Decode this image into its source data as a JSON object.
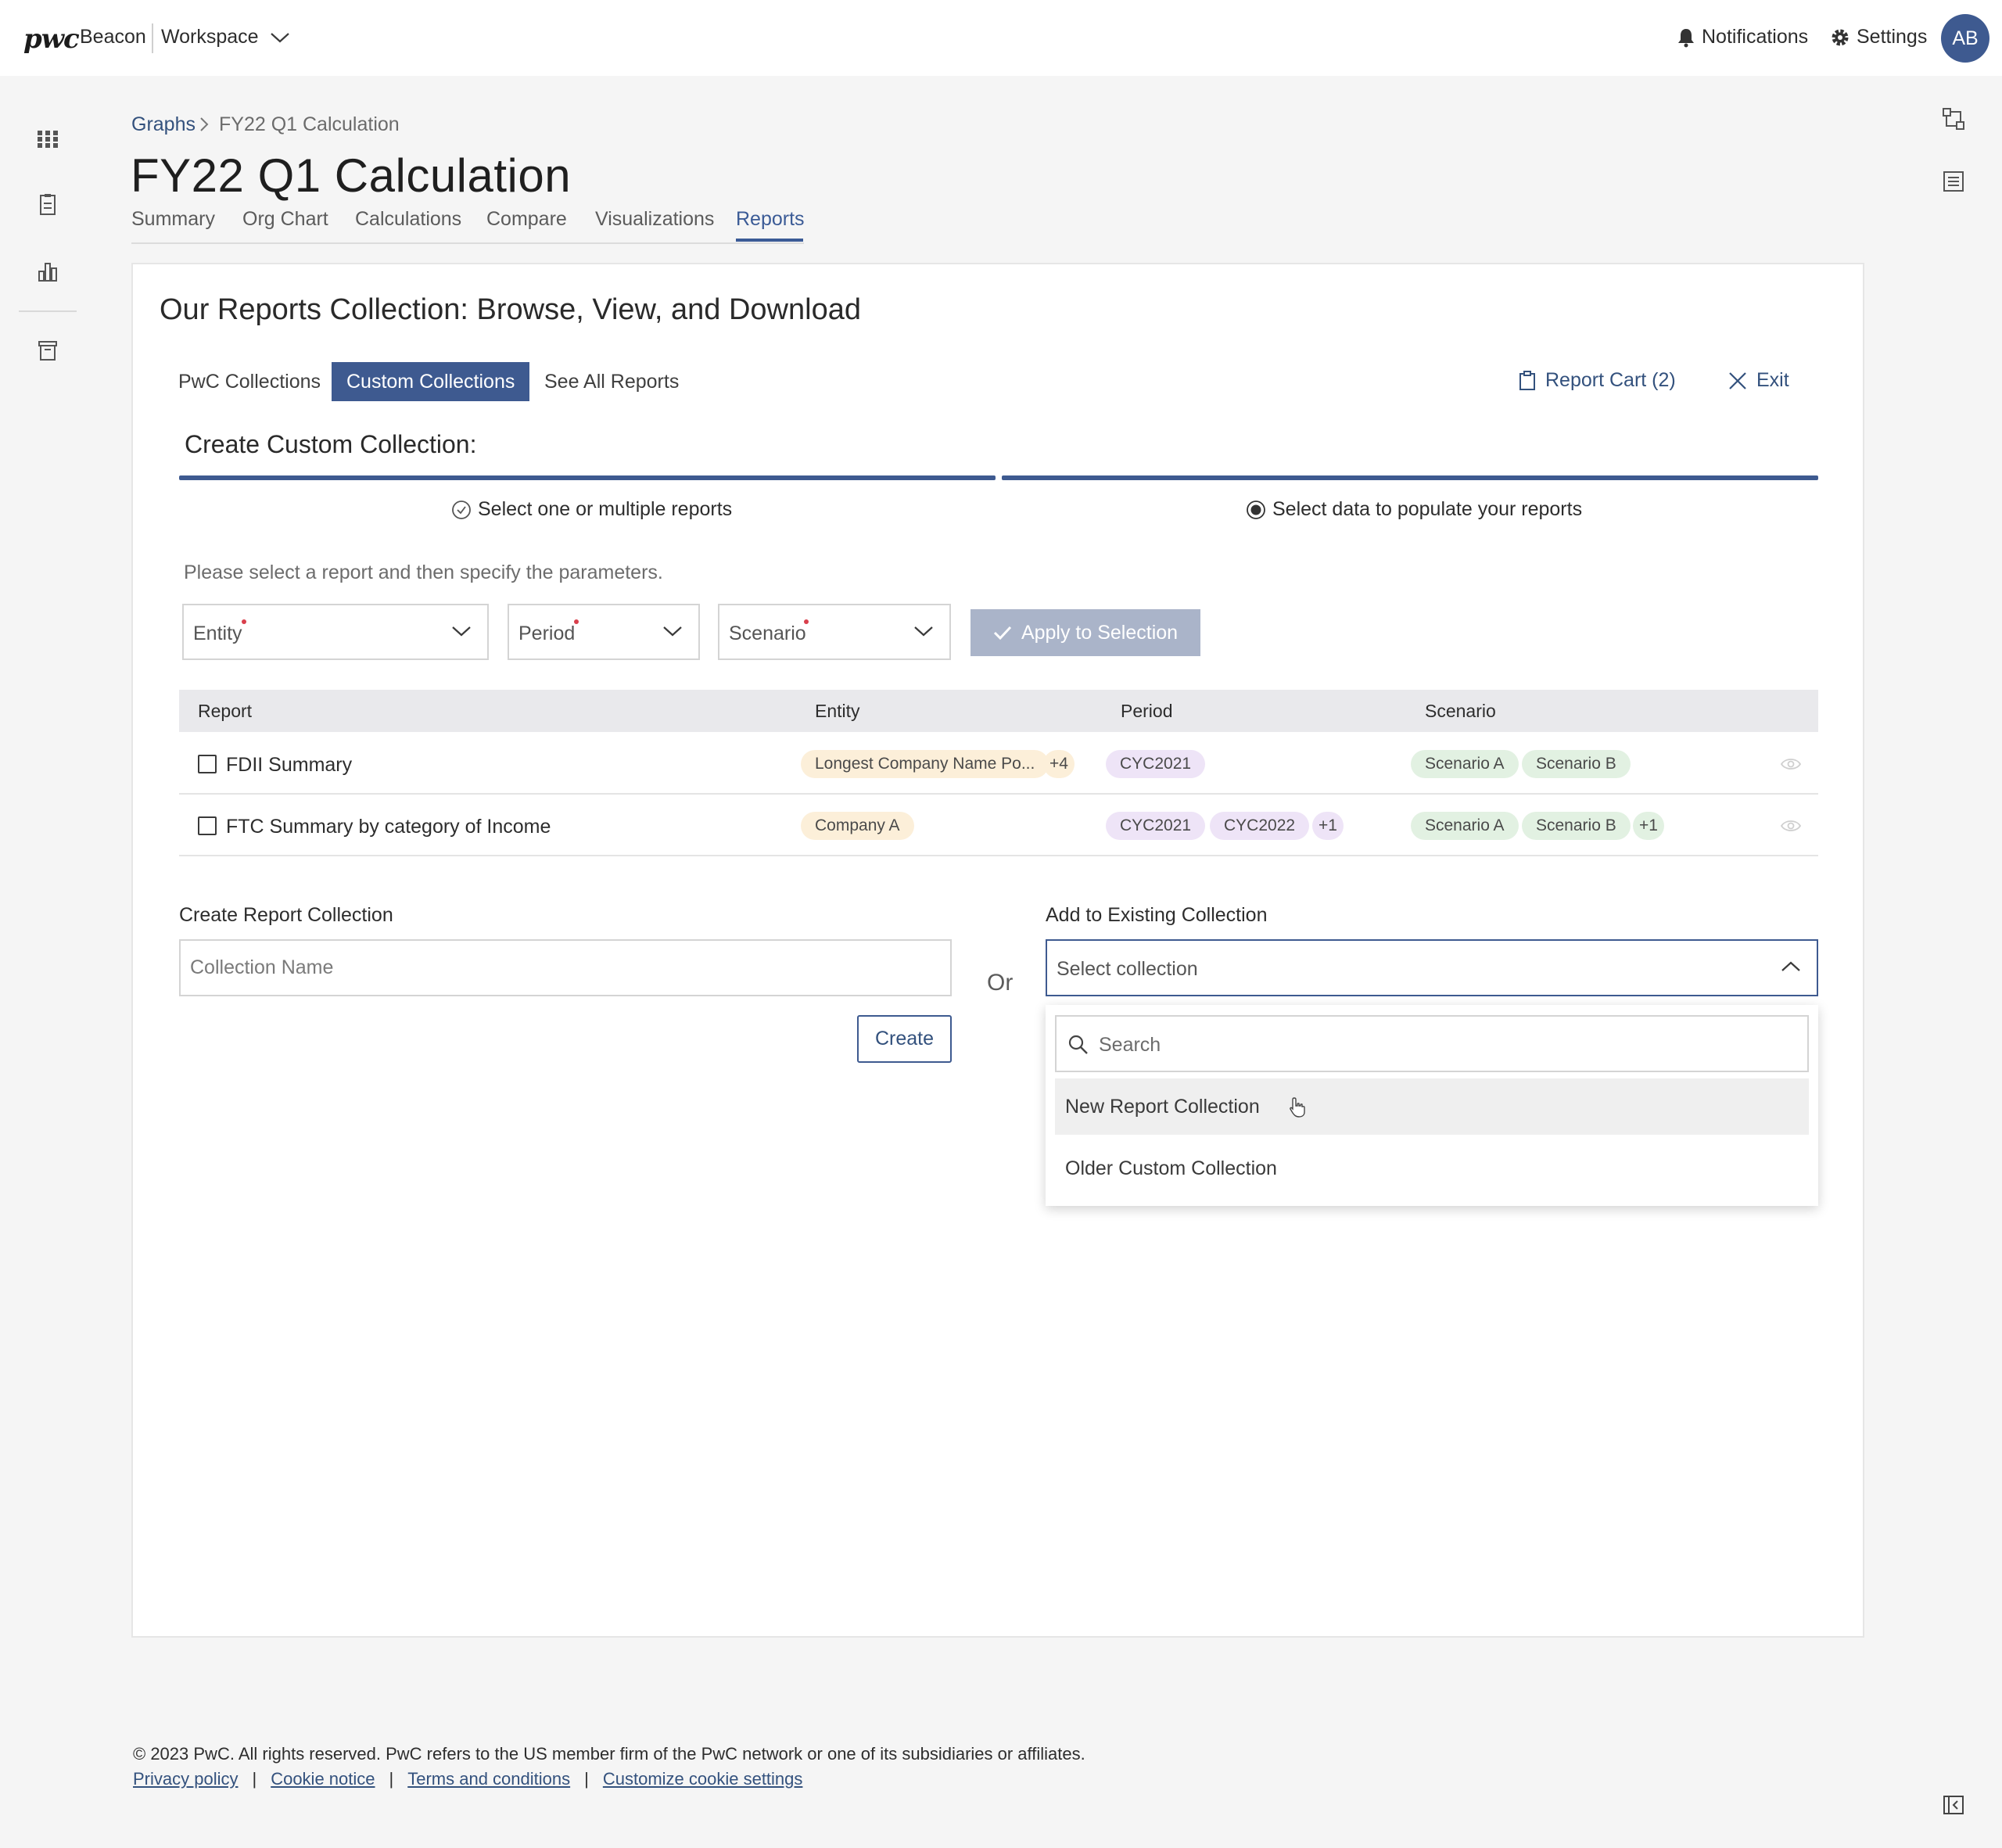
{
  "header": {
    "logo": "pwc",
    "product": "Beacon",
    "workspace": "Workspace",
    "notifications": "Notifications",
    "settings": "Settings",
    "avatar_initials": "AB"
  },
  "left_rail": {
    "icons": [
      "grid-icon",
      "document-icon",
      "chart-icon",
      "archive-icon"
    ]
  },
  "right_rail": {
    "icons": [
      "diagram-icon",
      "list-icon",
      "collapse-panel-icon"
    ]
  },
  "breadcrumb": {
    "parent": "Graphs",
    "current": "FY22 Q1 Calculation"
  },
  "page": {
    "title": "FY22 Q1 Calculation",
    "tabs": [
      {
        "label": "Summary"
      },
      {
        "label": "Org Chart"
      },
      {
        "label": "Calculations"
      },
      {
        "label": "Compare"
      },
      {
        "label": "Visualizations"
      },
      {
        "label": "Reports"
      }
    ],
    "active_tab": "Reports"
  },
  "reports": {
    "title": "Our Reports Collection: Browse, View, and Download",
    "subtabs": [
      {
        "label": "PwC Collections"
      },
      {
        "label": "Custom Collections"
      },
      {
        "label": "See All Reports"
      }
    ],
    "active_subtab": "Custom Collections",
    "cart_label": "Report Cart (2)",
    "exit_label": "Exit",
    "create_title": "Create Custom Collection:",
    "steps": [
      {
        "label": "Select one or multiple reports",
        "status": "completed"
      },
      {
        "label": "Select data to populate your reports",
        "status": "current"
      }
    ],
    "hint": "Please select a report and then specify the parameters.",
    "filters": {
      "entity": "Entity",
      "period": "Period",
      "scenario": "Scenario",
      "apply": "Apply to Selection"
    },
    "table": {
      "headers": [
        "Report",
        "Entity",
        "Period",
        "Scenario"
      ],
      "rows": [
        {
          "name": "FDII Summary",
          "entity": [
            "Longest Company Name Po..."
          ],
          "entity_more": "+4",
          "period": [
            "CYC2021"
          ],
          "period_more": "",
          "scenario": [
            "Scenario A",
            "Scenario B"
          ],
          "scenario_more": ""
        },
        {
          "name": "FTC Summary by category of Income",
          "entity": [
            "Company A"
          ],
          "entity_more": "",
          "period": [
            "CYC2021",
            "CYC2022"
          ],
          "period_more": "+1",
          "scenario": [
            "Scenario A",
            "Scenario B"
          ],
          "scenario_more": "+1"
        }
      ]
    },
    "create_collection": {
      "label": "Create Report Collection",
      "placeholder": "Collection Name",
      "button": "Create"
    },
    "or_label": "Or",
    "existing_collection": {
      "label": "Add to Existing Collection",
      "placeholder": "Select collection",
      "search_placeholder": "Search",
      "options": [
        "New Report Collection",
        "Older Custom Collection"
      ]
    }
  },
  "footer": {
    "copyright": "© 2023 PwC. All rights reserved. PwC refers to the US member firm of the PwC network or one of its subsidiaries or affiliates.",
    "links": [
      "Privacy policy",
      "Cookie notice",
      "Terms and conditions",
      "Customize cookie settings"
    ]
  },
  "colors": {
    "brand": "#3e5a90",
    "link": "#33517d",
    "required": "#d93f4c"
  }
}
